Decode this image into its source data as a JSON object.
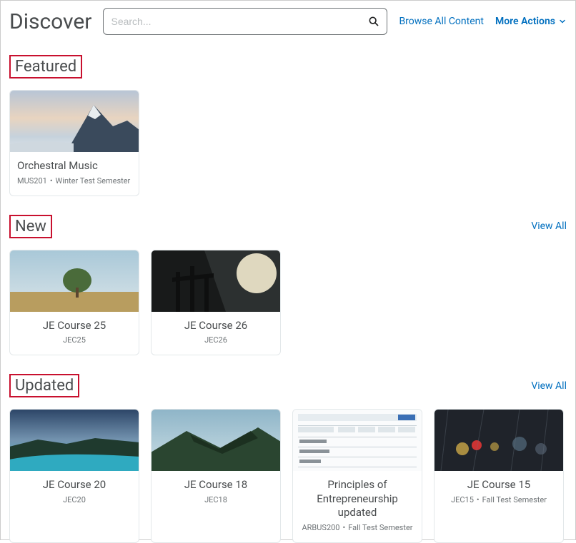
{
  "header": {
    "title": "Discover",
    "search_placeholder": "Search...",
    "browse_label": "Browse All Content",
    "more_actions_label": "More Actions"
  },
  "sections": {
    "featured": {
      "title": "Featured",
      "view_all": null,
      "cards": [
        {
          "title": "Orchestral Music",
          "code": "MUS201",
          "term": "Winter Test Semester"
        }
      ]
    },
    "new": {
      "title": "New",
      "view_all": "View All",
      "cards": [
        {
          "title": "JE Course 25",
          "code": "JEC25",
          "term": null
        },
        {
          "title": "JE Course 26",
          "code": "JEC26",
          "term": null
        }
      ]
    },
    "updated": {
      "title": "Updated",
      "view_all": "View All",
      "cards": [
        {
          "title": "JE Course 20",
          "code": "JEC20",
          "term": null
        },
        {
          "title": "JE Course 18",
          "code": "JEC18",
          "term": null
        },
        {
          "title": "Principles of Entrepreneurship updated",
          "code": "ARBUS200",
          "term": "Fall Test Semester"
        },
        {
          "title": "JE Course 15",
          "code": "JEC15",
          "term": "Fall Test Semester"
        }
      ]
    }
  }
}
